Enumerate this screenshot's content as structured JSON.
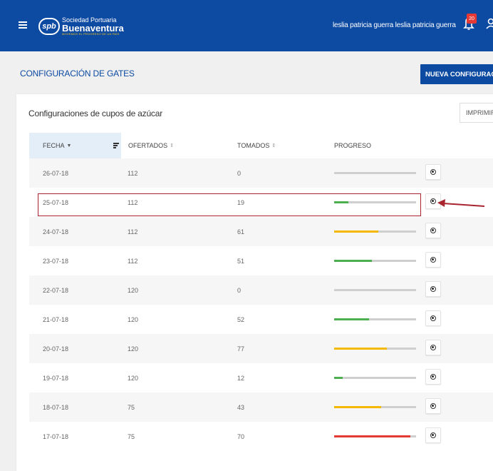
{
  "header": {
    "logo_mark": "spb",
    "logo_line1": "Sociedad Portuaria",
    "logo_line2": "Buenaventura",
    "logo_tagline": "MOVEMOS EL PROGRESO DE UN PAÍS",
    "username": "leslia patricia guerra leslia patricia guerra",
    "notification_count": "20"
  },
  "page": {
    "title": "CONFIGURACIÓN DE GATES",
    "new_button": "NUEVA CONFIGURACIÓN"
  },
  "card": {
    "title": "Configuraciones de cupos de azúcar",
    "print_button": "IMPRIMIR"
  },
  "table": {
    "headers": {
      "fecha": "FECHA",
      "ofertados": "OFERTADOS",
      "tomados": "TOMADOS",
      "progreso": "PROGRESO"
    },
    "rows": [
      {
        "fecha": "26-07-18",
        "ofertados": "112",
        "tomados": "0",
        "progress": 0,
        "color": "#4caf50"
      },
      {
        "fecha": "25-07-18",
        "ofertados": "112",
        "tomados": "19",
        "progress": 0.17,
        "color": "#4caf50"
      },
      {
        "fecha": "24-07-18",
        "ofertados": "112",
        "tomados": "61",
        "progress": 0.54,
        "color": "#f5b800"
      },
      {
        "fecha": "23-07-18",
        "ofertados": "112",
        "tomados": "51",
        "progress": 0.46,
        "color": "#4caf50"
      },
      {
        "fecha": "22-07-18",
        "ofertados": "120",
        "tomados": "0",
        "progress": 0,
        "color": "#4caf50"
      },
      {
        "fecha": "21-07-18",
        "ofertados": "120",
        "tomados": "52",
        "progress": 0.43,
        "color": "#4caf50"
      },
      {
        "fecha": "20-07-18",
        "ofertados": "120",
        "tomados": "77",
        "progress": 0.64,
        "color": "#f5b800"
      },
      {
        "fecha": "19-07-18",
        "ofertados": "120",
        "tomados": "12",
        "progress": 0.1,
        "color": "#4caf50"
      },
      {
        "fecha": "18-07-18",
        "ofertados": "75",
        "tomados": "43",
        "progress": 0.57,
        "color": "#f5b800"
      },
      {
        "fecha": "17-07-18",
        "ofertados": "75",
        "tomados": "70",
        "progress": 0.93,
        "color": "#e53935"
      }
    ]
  },
  "colors": {
    "brand": "#0d4aa2",
    "annotation": "#a8242f"
  }
}
